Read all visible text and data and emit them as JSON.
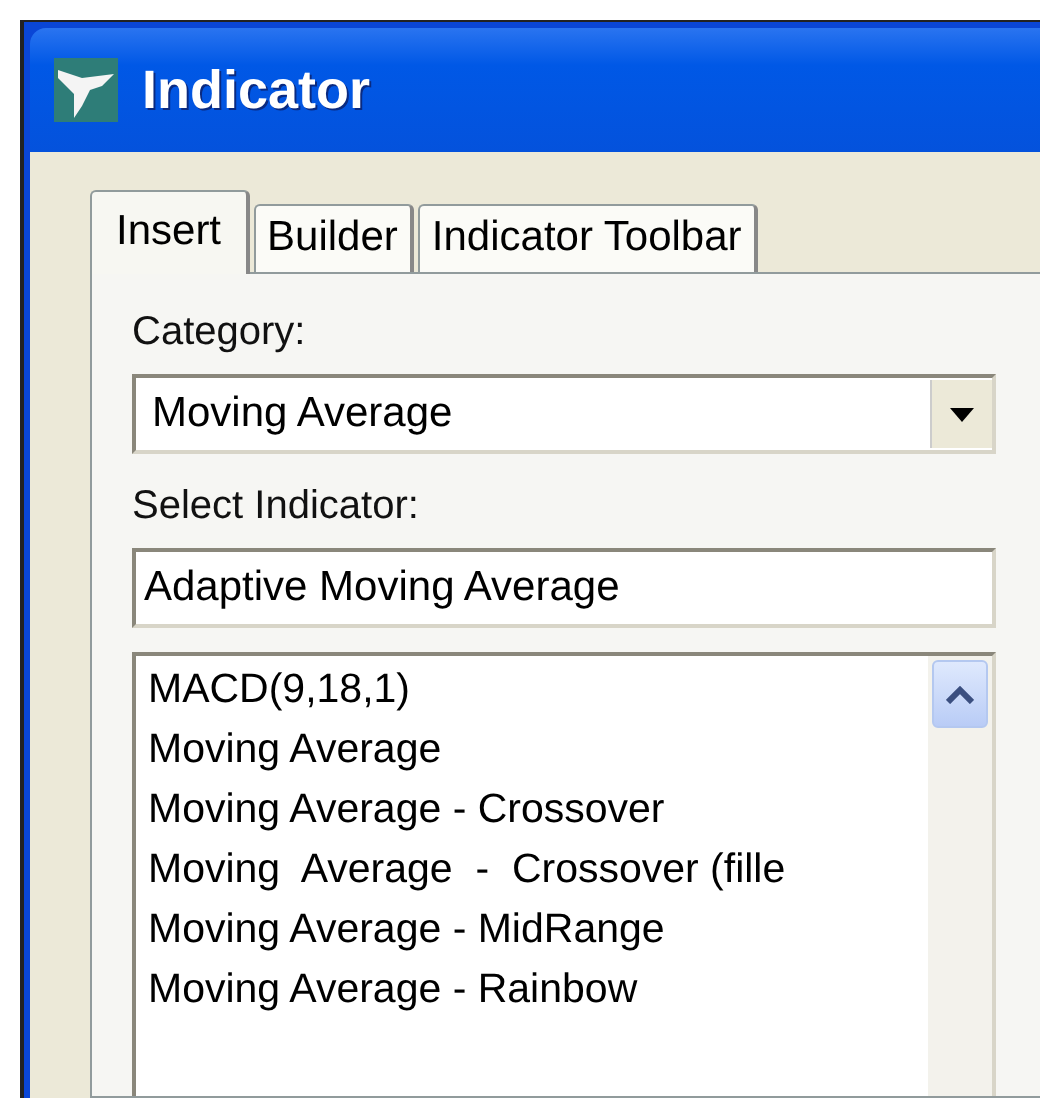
{
  "window": {
    "title": "Indicator"
  },
  "tabs": [
    {
      "label": "Insert",
      "selected": true
    },
    {
      "label": "Builder",
      "selected": false
    },
    {
      "label": "Indicator Toolbar",
      "selected": false
    }
  ],
  "category": {
    "label": "Category:",
    "value": "Moving Average"
  },
  "select_indicator": {
    "label": "Select Indicator:",
    "value": "Adaptive Moving Average"
  },
  "indicator_list": [
    {
      "label": "MACD(9,18,1)",
      "selected": false
    },
    {
      "label": "Moving Average",
      "selected": false
    },
    {
      "label": "Moving Average - Crossover",
      "selected": false
    },
    {
      "label": "Moving  Average  -  Crossover (fille",
      "selected": false
    },
    {
      "label": "Moving Average - MidRange",
      "selected": false
    },
    {
      "label": "Moving Average - Rainbow",
      "selected": false
    }
  ]
}
